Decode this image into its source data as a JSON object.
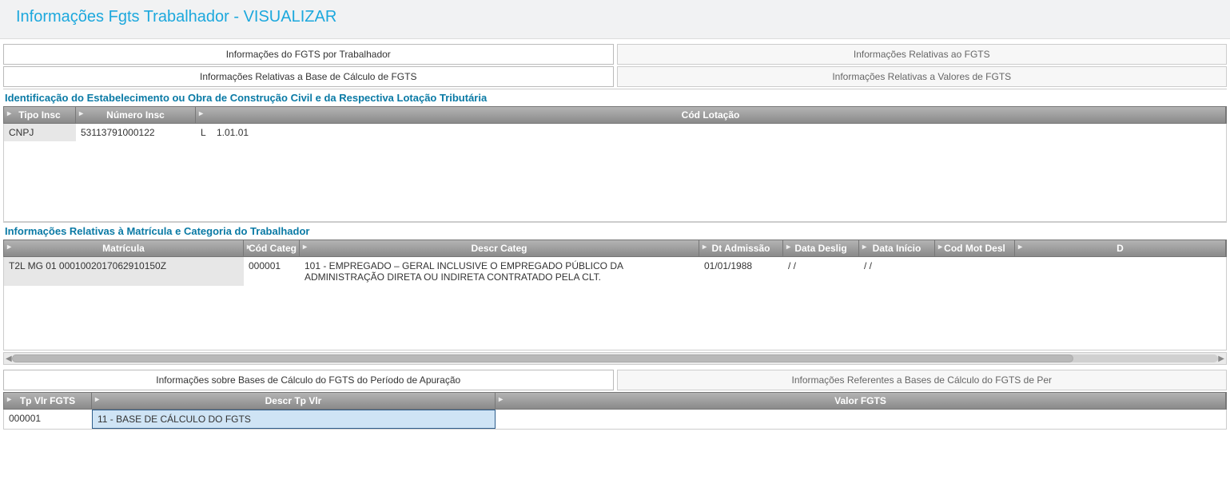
{
  "page_title": "Informações Fgts Trabalhador - VISUALIZAR",
  "tabs_top": {
    "left": "Informações do FGTS por Trabalhador",
    "right": "Informações Relativas ao FGTS"
  },
  "tabs_mid": {
    "left": "Informações Relativas a Base de Cálculo de FGTS",
    "right": "Informações Relativas a Valores de FGTS"
  },
  "section1": {
    "title": "Identificação do Estabelecimento ou Obra de Construção Civil e da Respectiva Lotação Tributária",
    "headers": {
      "tipo_insc": "Tipo Insc",
      "numero_insc": "Número Insc",
      "cod_lotacao": "Cód Lotação"
    },
    "row": {
      "tipo_insc": "CNPJ",
      "numero_insc": "53113791000122",
      "cod_lotacao_prefix": "L",
      "cod_lotacao": "1.01.01"
    }
  },
  "section2": {
    "title": "Informações Relativas à Matrícula e Categoria do Trabalhador",
    "headers": {
      "matricula": "Matrícula",
      "cod_categ": "Cód Categ",
      "descr_categ": "Descr Categ",
      "dt_admissao": "Dt Admissão",
      "data_deslig": "Data Deslig",
      "data_inicio": "Data Início",
      "cod_mot_desl": "Cod Mot Desl",
      "extra": "D"
    },
    "row": {
      "matricula": "T2L MG 01 0001002017062910150Z",
      "cod_categ": "000001",
      "descr_categ": "101 - EMPREGADO – GERAL INCLUSIVE O EMPREGADO PÚBLICO DA ADMINISTRAÇÃO DIRETA OU INDIRETA CONTRATADO PELA CLT.",
      "dt_admissao": "01/01/1988",
      "data_deslig": "  /  /",
      "data_inicio": "  /  /",
      "cod_mot_desl": ""
    }
  },
  "tabs_bottom": {
    "left": "Informações sobre Bases de Cálculo do FGTS do Período de Apuração",
    "right": "Informações Referentes a Bases de Cálculo do FGTS de Per"
  },
  "section3": {
    "headers": {
      "tp_vlr": "Tp Vlr FGTS",
      "descr_tp_vlr": "Descr Tp Vlr",
      "valor_fgts": "Valor FGTS"
    },
    "row": {
      "tp_vlr": "000001",
      "descr_tp_vlr": "11    - BASE DE CÁLCULO DO FGTS",
      "valor_fgts": ""
    }
  }
}
